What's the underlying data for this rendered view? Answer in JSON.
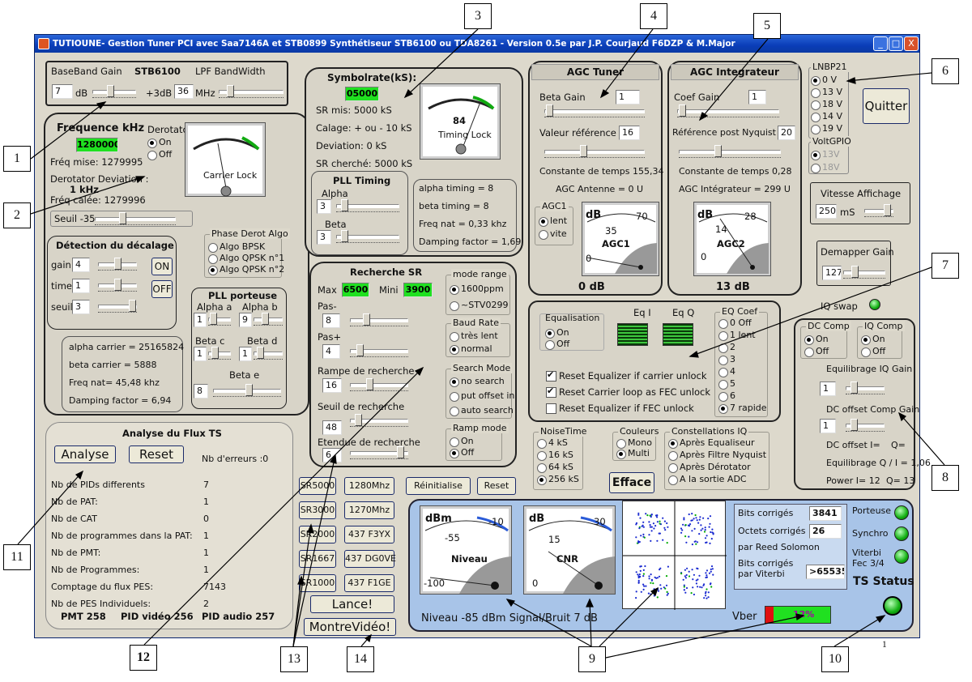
{
  "window": {
    "title": "TUTIOUNE- Gestion Tuner PCI avec Saa7146A et STB0899  Synthétiseur STB6100 ou TDA8261 - Version 0.5e par J.P. Courjaud F6DZP & M.Major",
    "minimize": "_",
    "maximize": "□",
    "close": "X"
  },
  "baseband": {
    "gain_label": "BaseBand Gain",
    "chip": "STB6100",
    "lpf_label": "LPF BandWidth",
    "gain_value": "7",
    "gain_unit": "dB",
    "plus3": "+3dB",
    "bw_value": "36",
    "bw_unit": "MHz"
  },
  "freq": {
    "title": "Frequence kHz",
    "value": "1280000",
    "mise": "Fréq mise: 1279995",
    "dev_label": "Derotator Deviation :",
    "dev_value": "1 kHz",
    "calee": "Fréq calée: 1279996",
    "derotator": "Derotator",
    "on": "On",
    "off": "Off",
    "meter": "Carrier Lock",
    "seuil": "Seuil -35"
  },
  "decalage": {
    "title": "Détection du décalage",
    "gain": "gain",
    "gain_v": "4",
    "time": "time",
    "time_v": "1",
    "seuil": "seuil",
    "seuil_v": "3",
    "on": "ON",
    "off": "OFF"
  },
  "phase": {
    "title": "Phase Derot Algo",
    "o1": "Algo BPSK",
    "o2": "Algo QPSK n°1",
    "o3": "Algo QPSK n°2"
  },
  "pllp": {
    "title": "PLL porteuse",
    "aa": "Alpha a",
    "aa_v": "1",
    "ab": "Alpha b",
    "ab_v": "9",
    "bc": "Beta c",
    "bc_v": "1",
    "bd": "Beta d",
    "bd_v": "1",
    "be": "Beta e",
    "be_v": "8"
  },
  "carrier": {
    "l1": "alpha carrier = 25165824",
    "l2": "beta carrier = 5888",
    "l3": "Freq nat= 45,48 khz",
    "l4": "Damping factor = 6,94"
  },
  "sr": {
    "title": "Symbolrate(kS):",
    "value": "05000",
    "mis": "SR mis: 5000 kS",
    "calage": "Calage: + ou - 10 kS",
    "deviation": "Deviation:    0 kS",
    "cherche": "SR cherché: 5000 kS",
    "meter_val": "84",
    "meter": "Timing Lock"
  },
  "pllt": {
    "title": "PLL Timing",
    "alpha": "Alpha",
    "alpha_v": "3",
    "beta": "Beta",
    "beta_v": "3",
    "l1": "alpha timing = 8",
    "l2": "beta timing = 8",
    "l3": "Freq nat = 0,33 khz",
    "l4": "Damping factor = 1,69"
  },
  "rech": {
    "title": "Recherche SR",
    "max": "Max",
    "max_v": "6500",
    "mini": "Mini",
    "mini_v": "3900",
    "pasm": "Pas-",
    "pasm_v": "8",
    "pasp": "Pas+",
    "pasp_v": "4",
    "rampe": "Rampe de recherche",
    "rampe_v": "16",
    "seuil": "Seuil de recherche",
    "seuil_v": "48",
    "etendue": "Etendue de recherche",
    "etendue_v": "6",
    "mode_range": "mode range",
    "mr1": "1600ppm",
    "mr2": "~STV0299",
    "baud": "Baud Rate",
    "br1": "très lent",
    "br2": "normal",
    "search": "Search Mode",
    "sm1": "no search",
    "sm2": "put offset in",
    "sm3": "auto search",
    "ramp": "Ramp mode",
    "rm1": "On",
    "rm2": "Off"
  },
  "presets": {
    "sr5000": "SR5000",
    "sr3000": "SR3000",
    "sr2000": "SR2000",
    "sr1667": "SR1667",
    "sr1000": "SR1000",
    "f1280": "1280Mhz",
    "f1270": "1270Mhz",
    "f437a": "437 F3YX",
    "f437b": "437 DG0VE",
    "f437c": "437 F1GE",
    "reinit": "Réinitialise",
    "reset": "Reset",
    "lance": "Lance!",
    "montre": "MontreVidéo!"
  },
  "agct": {
    "title": "AGC Tuner",
    "beta": "Beta Gain",
    "beta_v": "1",
    "vref": "Valeur référence",
    "vref_v": "16",
    "const": "Constante de temps 155,34",
    "ant": "AGC Antenne =  0 U",
    "agc1": "AGC1",
    "lent": "lent",
    "vite": "vite",
    "m_unit": "dB",
    "m_a": "70",
    "m_b": "35",
    "m_c": "0",
    "m_name": "AGC1",
    "db": "0 dB"
  },
  "agci": {
    "title": "AGC Integrateur",
    "coef": "Coef Gain",
    "coef_v": "1",
    "ref": "Référence post Nyquist",
    "ref_v": "20",
    "const": "Constante de temps 0,28",
    "integ": "AGC Intégrateur =  299 U",
    "m_unit": "dB",
    "m_a": "28",
    "m_b": "14",
    "m_c": "0",
    "m_name": "AGC2",
    "db": "13 dB"
  },
  "lnb": {
    "title": "LNBP21",
    "v1": "0 V",
    "v2": "13 V",
    "v3": "18 V",
    "v4": "14 V",
    "v5": "19 V",
    "volt": "VoltGPIO",
    "g1": "13V",
    "g2": "18V",
    "quit": "Quitter"
  },
  "vitesse": {
    "title": "Vitesse Affichage",
    "v": "250",
    "unit": "mS"
  },
  "demap": {
    "title": "Demapper Gain",
    "v": "127"
  },
  "iqswap": "IQ swap",
  "eq": {
    "title": "Equalisation",
    "on": "On",
    "off": "Off",
    "eqi": "Eq I",
    "eqq": "Eq Q",
    "coef": "EQ Coef",
    "c0": "0 Off",
    "c1": "1 lent",
    "c2": "2",
    "c3": "3",
    "c4": "4",
    "c5": "5",
    "c6": "6",
    "c7": "7 rapide",
    "r1": "Reset Equalizer if carrier unlock",
    "r2": "Reset Carrier loop as FEC unlock",
    "r3": "Reset Equalizer if FEC unlock"
  },
  "dc": {
    "dc": "DC Comp",
    "iq": "IQ Comp",
    "on": "On",
    "off": "Off",
    "eqgain": "Equilibrage IQ Gain",
    "eqgain_v": "1",
    "offset": "DC offset Comp Gain",
    "offset_v": "1",
    "l1": "DC offset I=",
    "l1b": "Q=",
    "l2": "Equilibrage Q / I =  1,06",
    "l3": "Power I=  12",
    "l3b": "Q=  13"
  },
  "noise": {
    "title": "NoiseTime",
    "n1": "4 kS",
    "n2": "16 kS",
    "n3": "64 kS",
    "n4": "256 kS"
  },
  "colors": {
    "title": "Couleurs",
    "mono": "Mono",
    "multi": "Multi",
    "efface": "Efface"
  },
  "const": {
    "title": "Constellations IQ",
    "c1": "Après Equaliseur",
    "c2": "Après Filtre Nyquist",
    "c3": "Après Dérotator",
    "c4": "A la sortie ADC"
  },
  "flux": {
    "title": "Analyse du Flux TS",
    "analyse": "Analyse",
    "reset": "Reset",
    "errors": "Nb d'erreurs :0",
    "rows": [
      [
        "Nb de PIDs differents",
        "7"
      ],
      [
        "Nb de PAT:",
        "1"
      ],
      [
        "Nb de CAT",
        "0"
      ],
      [
        "Nb de programmes dans la PAT:",
        "1"
      ],
      [
        "Nb de PMT:",
        "1"
      ],
      [
        "Nb de Programmes:",
        "1"
      ],
      [
        "Comptage du flux PES:",
        "7143"
      ],
      [
        "Nb de PES Individuels:",
        "2"
      ]
    ],
    "pmt": "PMT 258",
    "pidv": "PID vidéo 256",
    "pida": "PID audio 257"
  },
  "status": {
    "dbm": "dBm",
    "n10": "-10",
    "n55": "-55",
    "n100": "-100",
    "niveau": "Niveau",
    "db": "dB",
    "c30": "30",
    "c15": "15",
    "c0": "0",
    "cnr": "CNR",
    "bits": "Bits corrigés",
    "bits_v": "3841",
    "octets": "Octets corrigés",
    "octets_v": "26",
    "rs": "par Reed Solomon",
    "bitsv": "Bits corrigés par Viterbi",
    "bitsv_v": ">65535",
    "porteuse": "Porteuse",
    "synchro": "Synchro",
    "viterbi": "Viterbi Fec 3/4",
    "ts": "TS Status",
    "summary": "Niveau  -85 dBm Signal/Bruit 7 dB",
    "vber": "Vber",
    "vber_pct": "12%",
    "vber_frac": 0.12
  },
  "page_no": "1",
  "callouts": [
    "1",
    "2",
    "3",
    "4",
    "5",
    "6",
    "7",
    "8",
    "9",
    "10",
    "11",
    "12",
    "13",
    "14"
  ],
  "colors_ui": {
    "led": "#12b012",
    "lcd": "#20e020",
    "title": "#0a3db8",
    "vber": "#e01010"
  }
}
